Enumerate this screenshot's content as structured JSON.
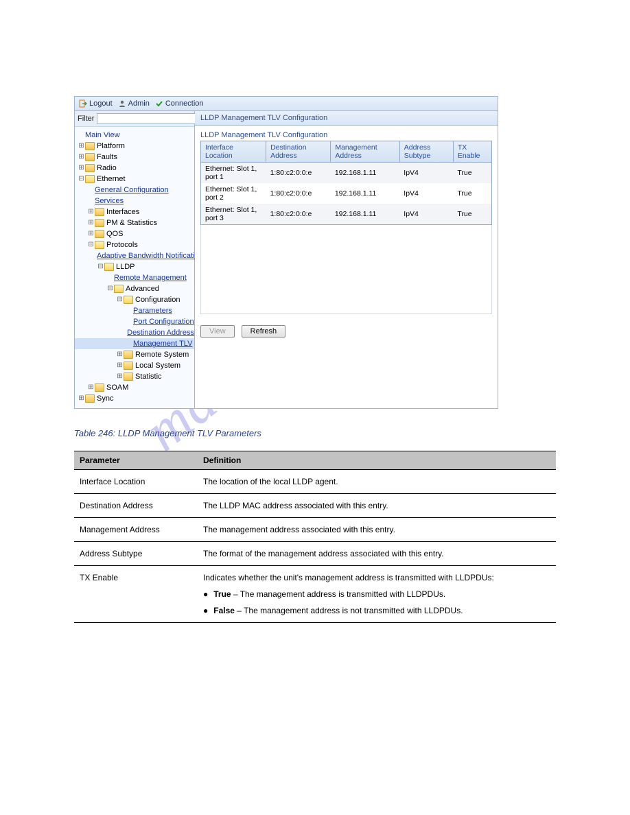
{
  "watermark": "manualshive.com",
  "header": {
    "logout": "Logout",
    "admin": "Admin",
    "connection": "Connection"
  },
  "sidebar": {
    "filter_label": "Filter",
    "filter_placeholder": "",
    "main_view": "Main View",
    "items": {
      "platform": "Platform",
      "faults": "Faults",
      "radio": "Radio",
      "ethernet": "Ethernet",
      "general_configuration": "General Configuration",
      "services": "Services",
      "interfaces": "Interfaces",
      "pm_statistics": "PM & Statistics",
      "qos": "QOS",
      "protocols": "Protocols",
      "adaptive_bw": "Adaptive Bandwidth Notification",
      "lldp": "LLDP",
      "remote_mgmt": "Remote Management",
      "advanced": "Advanced",
      "configuration": "Configuration",
      "parameters": "Parameters",
      "port_config": "Port Configuration",
      "dest_addr": "Destination Address",
      "mgmt_tlv": "Management TLV",
      "remote_system": "Remote System",
      "local_system": "Local System",
      "statistic": "Statistic",
      "soam": "SOAM",
      "sync": "Sync"
    }
  },
  "content": {
    "title": "LLDP Management TLV Configuration",
    "section_title": "LLDP Management TLV Configuration",
    "columns": {
      "iface": "Interface Location",
      "dest": "Destination Address",
      "mgmt": "Management Address",
      "subtype": "Address Subtype",
      "tx": "TX Enable"
    },
    "rows": [
      {
        "iface": "Ethernet: Slot 1, port 1",
        "dest": "1:80:c2:0:0:e",
        "mgmt": "192.168.1.11",
        "subtype": "IpV4",
        "tx": "True"
      },
      {
        "iface": "Ethernet: Slot 1, port 2",
        "dest": "1:80:c2:0:0:e",
        "mgmt": "192.168.1.11",
        "subtype": "IpV4",
        "tx": "True"
      },
      {
        "iface": "Ethernet: Slot 1, port 3",
        "dest": "1:80:c2:0:0:e",
        "mgmt": "192.168.1.11",
        "subtype": "IpV4",
        "tx": "True"
      }
    ],
    "buttons": {
      "view": "View",
      "refresh": "Refresh"
    }
  },
  "doc": {
    "caption": "Table 246: LLDP Management TLV Parameters",
    "th_param": "Parameter",
    "th_def": "Definition",
    "rows": [
      {
        "param": "Interface Location",
        "def": "The location of the local LLDP agent."
      },
      {
        "param": "Destination Address",
        "def": "The LLDP MAC address associated with this entry."
      },
      {
        "param": "Management Address",
        "def": "The management address associated with this entry."
      },
      {
        "param": "Address Subtype",
        "def": "The format of the management address associated with this entry."
      }
    ],
    "tx_param": "TX Enable",
    "tx_def_intro": "Indicates whether the unit's management address is transmitted with LLDPDUs:",
    "tx_b1": "– The management address is transmitted with LLDPDUs.",
    "tx_b1_bold": "True",
    "tx_b2": "– The management address is not transmitted with LLDPDUs.",
    "tx_b2_bold": "False"
  }
}
